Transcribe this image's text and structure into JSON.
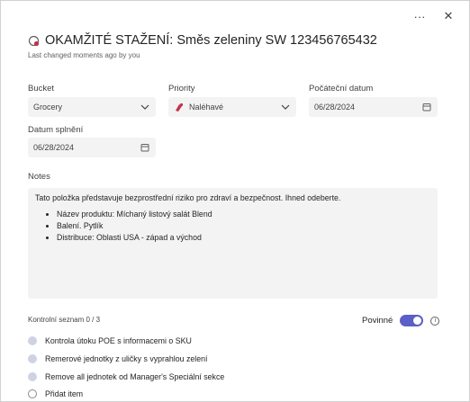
{
  "header": {
    "title": "OKAMŽITÉ STAŽENÍ: Směs zeleniny SW 123456765432",
    "subtitle": "Last changed moments ago by you"
  },
  "top_actions": {
    "more": "···",
    "close": "✕"
  },
  "fields": {
    "bucket": {
      "label": "Bucket",
      "value": "Grocery"
    },
    "priority": {
      "label": "Priority",
      "value": "Naléhavé"
    },
    "start_date": {
      "label": "Počáteční datum",
      "value": "06/28/2024"
    },
    "due_date": {
      "label": "Datum splnění",
      "value": "06/28/2024"
    }
  },
  "notes": {
    "label": "Notes",
    "intro": "Tato položka představuje bezprostřední riziko pro zdraví a bezpečnost. Ihned odeberte.",
    "bullets": [
      "Název produktu: Míchaný listový salát Blend",
      "Balení. Pytlík",
      "Distribuce: Oblasti USA - západ a východ"
    ]
  },
  "checklist": {
    "header": "Kontrolní seznam 0 / 3",
    "required_label": "Povinné",
    "required_on": true,
    "items": [
      "Kontrola útoku POE s informacemi o SKU",
      "Remerové jednotky z uličky s vyprahlou zelení",
      "Remove all jednotek od Manager's Speciální sekce"
    ],
    "add_item": "Přidat item"
  },
  "colors": {
    "accent": "#5b5fc7",
    "priority_icon": "#c4314b"
  }
}
